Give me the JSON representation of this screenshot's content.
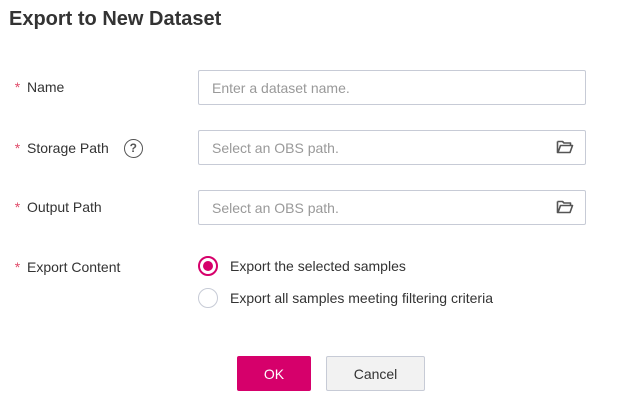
{
  "dialog": {
    "title": "Export to New Dataset"
  },
  "required_mark": "*",
  "fields": {
    "name": {
      "label": "Name",
      "placeholder": "Enter a dataset name.",
      "value": ""
    },
    "storage_path": {
      "label": "Storage Path",
      "help": "?",
      "placeholder": "Select an OBS path.",
      "value": ""
    },
    "output_path": {
      "label": "Output Path",
      "placeholder": "Select an OBS path.",
      "value": ""
    },
    "export_content": {
      "label": "Export Content",
      "options": [
        {
          "label": "Export the selected samples",
          "selected": true
        },
        {
          "label": "Export all samples meeting filtering criteria",
          "selected": false
        }
      ]
    }
  },
  "buttons": {
    "ok": "OK",
    "cancel": "Cancel"
  },
  "colors": {
    "accent": "#d6006b",
    "required": "#e04b6a",
    "border": "#c7cbd6"
  },
  "icons": {
    "storage_path": "folder-open-icon",
    "output_path": "folder-open-icon",
    "help": "help-circle-icon"
  }
}
